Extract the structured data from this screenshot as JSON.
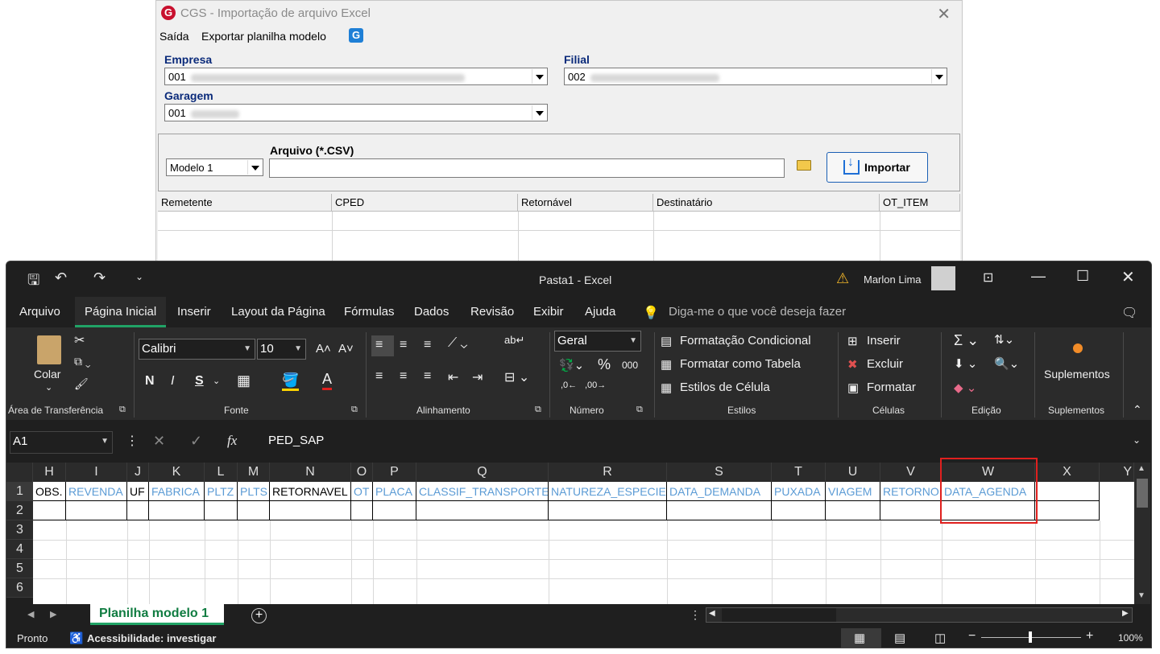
{
  "cgs": {
    "title": "CGS - Importação de arquivo Excel",
    "logo_letter": "G",
    "close_glyph": "✕",
    "menu": {
      "exit": "Saída",
      "export": "Exportar planilha modelo"
    },
    "empresa": {
      "label": "Empresa",
      "value": "001"
    },
    "filial": {
      "label": "Filial",
      "value": "002"
    },
    "garagem": {
      "label": "Garagem",
      "value": "001"
    },
    "modelo": {
      "value": "Modelo 1"
    },
    "arquivo": {
      "label": "Arquivo (*.CSV)",
      "value": ""
    },
    "import_button": "Importar",
    "grid_headers": [
      "Remetente",
      "CPED",
      "Retornável",
      "Destinatário",
      "OT_ITEM"
    ]
  },
  "excel": {
    "title": "Pasta1  -  Excel",
    "user": "Marlon Lima",
    "tabs": [
      "Arquivo",
      "Página Inicial",
      "Inserir",
      "Layout da Página",
      "Fórmulas",
      "Dados",
      "Revisão",
      "Exibir",
      "Ajuda"
    ],
    "search_placeholder": "Diga-me o que você deseja fazer",
    "ribbon": {
      "paste": "Colar",
      "font_name": "Calibri",
      "font_size": "10",
      "bold": "N",
      "italic": "I",
      "underline": "S",
      "number_format": "Geral",
      "cond_format": "Formatação Condicional",
      "format_table": "Formatar como Tabela",
      "cell_styles": "Estilos de Célula",
      "insert": "Inserir",
      "delete": "Excluir",
      "format": "Formatar",
      "addins": "Suplementos",
      "groups": [
        "Área de Transferência",
        "Fonte",
        "Alinhamento",
        "Número",
        "Estilos",
        "Células",
        "Edição",
        "Suplementos"
      ]
    },
    "name_box": "A1",
    "formula": "PED_SAP",
    "fx": "fx",
    "columns": [
      "H",
      "I",
      "J",
      "K",
      "L",
      "M",
      "N",
      "O",
      "P",
      "Q",
      "R",
      "S",
      "T",
      "U",
      "V",
      "W",
      "X",
      "Y"
    ],
    "rows": [
      "1",
      "2",
      "3",
      "4",
      "5",
      "6"
    ],
    "row1": [
      "OBS.",
      "REVENDA",
      "UF",
      "FABRICA",
      "PLTZ",
      "PLTS",
      "RETORNAVEL",
      "OT",
      "PLACA",
      "CLASSIF_TRANSPORTE",
      "NATUREZA_ESPECIE",
      "DATA_DEMANDA",
      "PUXADA",
      "VIAGEM",
      "RETORNO",
      "DATA_AGENDA"
    ],
    "row1_colors": [
      "black",
      "blue",
      "black",
      "blue",
      "blue",
      "blue",
      "black",
      "blue",
      "blue",
      "blue",
      "blue",
      "blue",
      "blue",
      "blue",
      "blue",
      "blue"
    ],
    "sheet_tab": "Planilha modelo 1",
    "status": "Pronto",
    "accessibility": "Acessibilidade: investigar",
    "zoom": "100%"
  }
}
